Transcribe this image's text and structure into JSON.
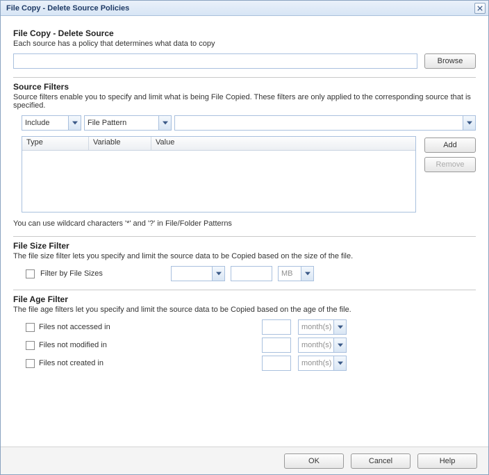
{
  "window": {
    "title": "File Copy - Delete Source Policies"
  },
  "header": {
    "title": "File Copy - Delete Source",
    "desc": "Each source has a policy that determines what data to copy"
  },
  "source_input": {
    "value": "",
    "browse_label": "Browse"
  },
  "source_filters": {
    "title": "Source Filters",
    "desc": "Source filters enable you to specify and limit what is being File Copied. These filters are only applied to the corresponding source that is specified.",
    "include_selected": "Include",
    "variable_selected": "File Pattern",
    "value_selected": "",
    "table": {
      "columns": {
        "type": "Type",
        "variable": "Variable",
        "value": "Value"
      },
      "rows": []
    },
    "add_label": "Add",
    "remove_label": "Remove",
    "hint": "You can use wildcard characters '*' and '?' in File/Folder Patterns"
  },
  "file_size": {
    "title": "File Size Filter",
    "desc": "The file size filter lets you specify and limit the source data to be Copied based on the size of the file.",
    "checkbox_label": "Filter by File Sizes",
    "op_selected": "",
    "value": "",
    "unit_selected": "MB"
  },
  "file_age": {
    "title": "File Age Filter",
    "desc": "The file age filters let you specify and limit the source data to be Copied based on the age of the file.",
    "rows": [
      {
        "label": "Files not accessed in",
        "value": "",
        "unit": "month(s)"
      },
      {
        "label": "Files not modified in",
        "value": "",
        "unit": "month(s)"
      },
      {
        "label": "Files not created in",
        "value": "",
        "unit": "month(s)"
      }
    ]
  },
  "footer": {
    "ok": "OK",
    "cancel": "Cancel",
    "help": "Help"
  }
}
